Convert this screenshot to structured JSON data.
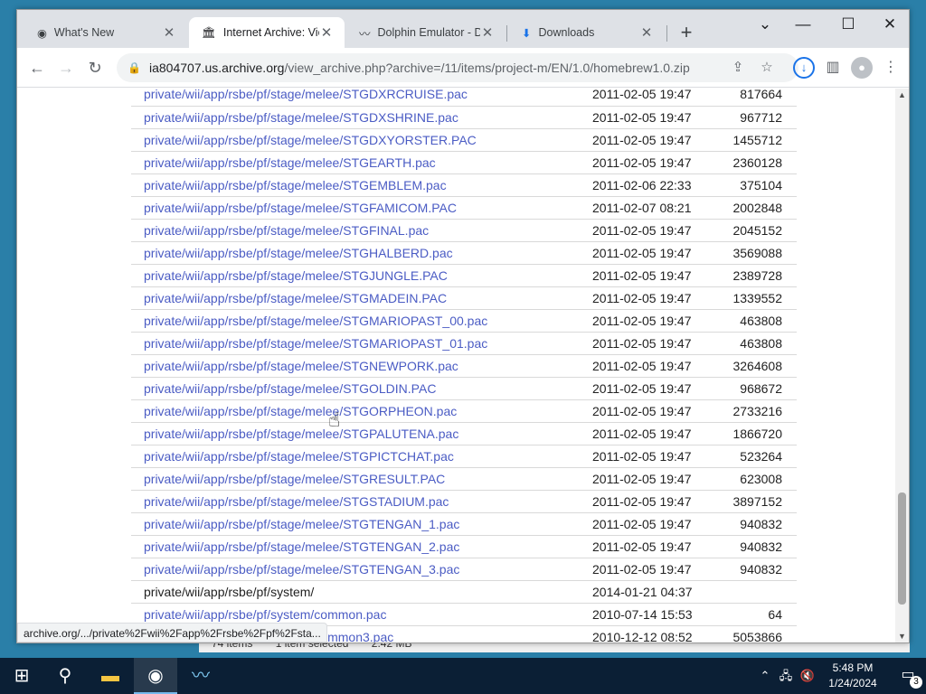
{
  "tabs": [
    {
      "title": "What's New",
      "icon": "chrome-icon",
      "active": false
    },
    {
      "title": "Internet Archive: Vie",
      "icon": "archive-icon",
      "active": true
    },
    {
      "title": "Dolphin Emulator - D",
      "icon": "dolphin-icon",
      "active": false
    },
    {
      "title": "Downloads",
      "icon": "download-icon",
      "active": false
    }
  ],
  "address": {
    "host": "ia804707.us.archive.org",
    "path": "/view_archive.php?archive=/11/items/project-m/EN/1.0/homebrew1.0.zip"
  },
  "rows": [
    {
      "name": "private/wii/app/rsbe/pf/stage/melee/STGDXRCRUISE.pac",
      "date": "2011-02-05 19:47",
      "size": "817664",
      "link": true
    },
    {
      "name": "private/wii/app/rsbe/pf/stage/melee/STGDXSHRINE.pac",
      "date": "2011-02-05 19:47",
      "size": "967712",
      "link": true
    },
    {
      "name": "private/wii/app/rsbe/pf/stage/melee/STGDXYORSTER.PAC",
      "date": "2011-02-05 19:47",
      "size": "1455712",
      "link": true
    },
    {
      "name": "private/wii/app/rsbe/pf/stage/melee/STGEARTH.pac",
      "date": "2011-02-05 19:47",
      "size": "2360128",
      "link": true
    },
    {
      "name": "private/wii/app/rsbe/pf/stage/melee/STGEMBLEM.pac",
      "date": "2011-02-06 22:33",
      "size": "375104",
      "link": true
    },
    {
      "name": "private/wii/app/rsbe/pf/stage/melee/STGFAMICOM.PAC",
      "date": "2011-02-07 08:21",
      "size": "2002848",
      "link": true
    },
    {
      "name": "private/wii/app/rsbe/pf/stage/melee/STGFINAL.pac",
      "date": "2011-02-05 19:47",
      "size": "2045152",
      "link": true
    },
    {
      "name": "private/wii/app/rsbe/pf/stage/melee/STGHALBERD.pac",
      "date": "2011-02-05 19:47",
      "size": "3569088",
      "link": true
    },
    {
      "name": "private/wii/app/rsbe/pf/stage/melee/STGJUNGLE.PAC",
      "date": "2011-02-05 19:47",
      "size": "2389728",
      "link": true
    },
    {
      "name": "private/wii/app/rsbe/pf/stage/melee/STGMADEIN.PAC",
      "date": "2011-02-05 19:47",
      "size": "1339552",
      "link": true
    },
    {
      "name": "private/wii/app/rsbe/pf/stage/melee/STGMARIOPAST_00.pac",
      "date": "2011-02-05 19:47",
      "size": "463808",
      "link": true
    },
    {
      "name": "private/wii/app/rsbe/pf/stage/melee/STGMARIOPAST_01.pac",
      "date": "2011-02-05 19:47",
      "size": "463808",
      "link": true
    },
    {
      "name": "private/wii/app/rsbe/pf/stage/melee/STGNEWPORK.pac",
      "date": "2011-02-05 19:47",
      "size": "3264608",
      "link": true
    },
    {
      "name": "private/wii/app/rsbe/pf/stage/melee/STGOLDIN.PAC",
      "date": "2011-02-05 19:47",
      "size": "968672",
      "link": true
    },
    {
      "name": "private/wii/app/rsbe/pf/stage/melee/STGORPHEON.pac",
      "date": "2011-02-05 19:47",
      "size": "2733216",
      "link": true
    },
    {
      "name": "private/wii/app/rsbe/pf/stage/melee/STGPALUTENA.pac",
      "date": "2011-02-05 19:47",
      "size": "1866720",
      "link": true
    },
    {
      "name": "private/wii/app/rsbe/pf/stage/melee/STGPICTCHAT.pac",
      "date": "2011-02-05 19:47",
      "size": "523264",
      "link": true
    },
    {
      "name": "private/wii/app/rsbe/pf/stage/melee/STGRESULT.PAC",
      "date": "2011-02-05 19:47",
      "size": "623008",
      "link": true
    },
    {
      "name": "private/wii/app/rsbe/pf/stage/melee/STGSTADIUM.pac",
      "date": "2011-02-05 19:47",
      "size": "3897152",
      "link": true
    },
    {
      "name": "private/wii/app/rsbe/pf/stage/melee/STGTENGAN_1.pac",
      "date": "2011-02-05 19:47",
      "size": "940832",
      "link": true
    },
    {
      "name": "private/wii/app/rsbe/pf/stage/melee/STGTENGAN_2.pac",
      "date": "2011-02-05 19:47",
      "size": "940832",
      "link": true
    },
    {
      "name": "private/wii/app/rsbe/pf/stage/melee/STGTENGAN_3.pac",
      "date": "2011-02-05 19:47",
      "size": "940832",
      "link": true
    },
    {
      "name": "private/wii/app/rsbe/pf/system/",
      "date": "2014-01-21 04:37",
      "size": "",
      "link": false
    },
    {
      "name": "private/wii/app/rsbe/pf/system/common.pac",
      "date": "2010-07-14 15:53",
      "size": "64",
      "link": true
    },
    {
      "name": "private/wii/app/rsbe/pf/system/common3.pac",
      "date": "2010-12-12 08:52",
      "size": "5053866",
      "link": true
    }
  ],
  "status_url": "archive.org/.../private%2Fwii%2Fapp%2Frsbe%2Fpf%2Fsta...",
  "behind_window": {
    "items_count": "74 items",
    "selected": "1 item selected",
    "size": "2.42 MB"
  },
  "clock": {
    "time": "5:48 PM",
    "date": "1/24/2024"
  },
  "notifications": "3"
}
